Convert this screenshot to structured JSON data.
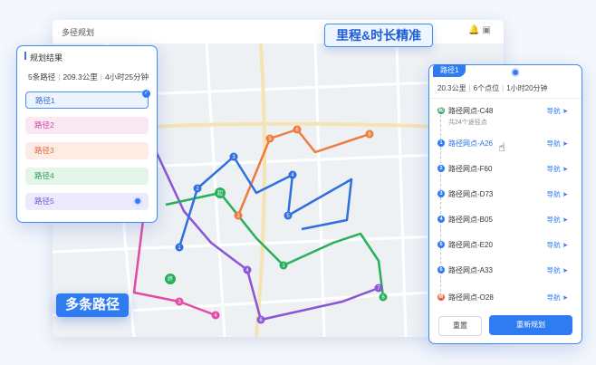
{
  "window": {
    "title": "多径规划",
    "tools": "🔔 ▣"
  },
  "callouts": {
    "top": "里程&时长精准",
    "bottom": "多条路径"
  },
  "plan_panel": {
    "title": "规划结果",
    "count": "5条路径",
    "distance": "209.3公里",
    "duration": "4小时25分钟",
    "routes": [
      "路径1",
      "路径2",
      "路径3",
      "路径4",
      "路径5"
    ]
  },
  "route_panel": {
    "tab": "路径1",
    "distance": "20.3公里",
    "points": "6个点位",
    "duration": "1小时20分钟",
    "waypoints": [
      {
        "icon": "起",
        "name": "路径网点-C48",
        "sub": "共24个途径点",
        "nav": "导航",
        "color": "#2ea566"
      },
      {
        "icon": "1",
        "name": "路径网点-A26",
        "nav": "导航",
        "color": "#2f7bf2"
      },
      {
        "icon": "2",
        "name": "路径网点-F60",
        "nav": "导航",
        "color": "#2f7bf2"
      },
      {
        "icon": "3",
        "name": "路径网点-D73",
        "nav": "导航",
        "color": "#2f7bf2"
      },
      {
        "icon": "4",
        "name": "路径网点-B05",
        "nav": "导航",
        "color": "#2f7bf2"
      },
      {
        "icon": "5",
        "name": "路径网点-E20",
        "nav": "导航",
        "color": "#2f7bf2"
      },
      {
        "icon": "6",
        "name": "路径网点-A33",
        "nav": "导航",
        "color": "#2f7bf2"
      },
      {
        "icon": "终",
        "name": "路径网点-O28",
        "nav": "导航",
        "color": "#e25b3c"
      }
    ],
    "reset": "重置",
    "replan": "重新规划"
  },
  "map": {
    "zoom_in": "+",
    "zoom_out": "−"
  },
  "colors": {
    "accent": "#2f7bf2",
    "route1": "#2f6fe0",
    "route2": "#e24aa6",
    "route3": "#f07a3c",
    "route4": "#27b05a",
    "route5": "#8a55d6"
  }
}
